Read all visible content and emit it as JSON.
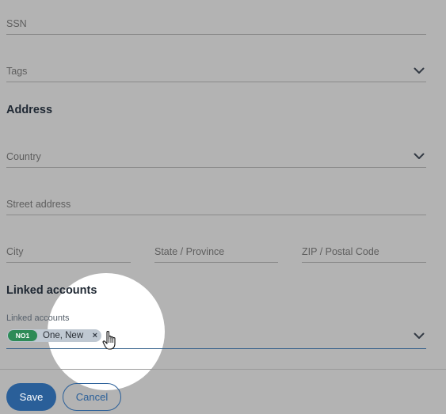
{
  "fields": {
    "ssn": {
      "placeholder": "SSN"
    },
    "tags": {
      "placeholder": "Tags"
    },
    "country": {
      "placeholder": "Country"
    },
    "street": {
      "placeholder": "Street address"
    },
    "city": {
      "placeholder": "City"
    },
    "state": {
      "placeholder": "State / Province"
    },
    "zip": {
      "placeholder": "ZIP / Postal Code"
    }
  },
  "sections": {
    "address": "Address",
    "linked": "Linked accounts"
  },
  "linked_accounts": {
    "label": "Linked accounts",
    "chips": [
      {
        "code": "NO1",
        "name": "One, New",
        "remove": "×"
      }
    ]
  },
  "buttons": {
    "save": "Save",
    "cancel": "Cancel"
  },
  "icons": {
    "dropdown": "chevron-down-icon",
    "cursor": "hand-pointer-icon"
  },
  "colors": {
    "primary": "#2a5f99",
    "chip_code": "#2e8b57",
    "overlay": "#b3b3b3"
  }
}
